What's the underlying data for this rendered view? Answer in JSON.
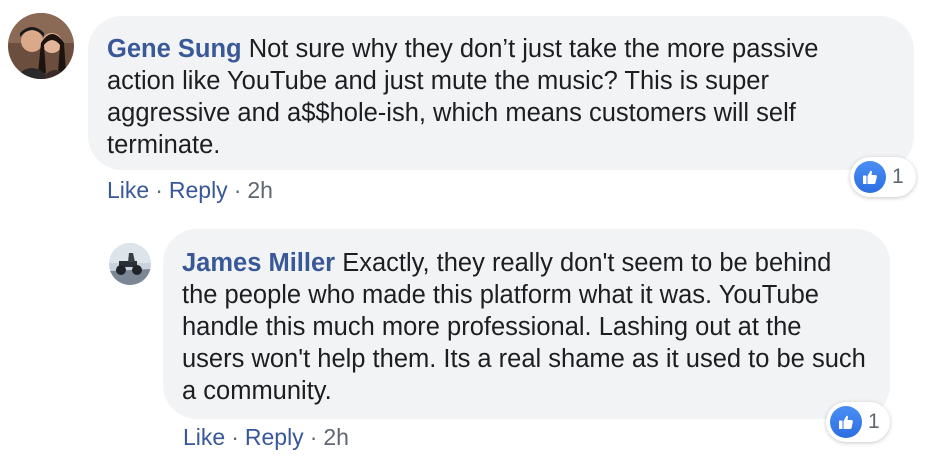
{
  "comments": [
    {
      "author": "Gene Sung",
      "text": "Not sure why they don’t just take the more passive action like YouTube and just mute the music? This is super aggressive and a$$hole-ish, which means customers will self terminate.",
      "reaction_count": "1",
      "actions": {
        "like": "Like",
        "reply": "Reply",
        "separator": "·",
        "time": "2h"
      }
    },
    {
      "author": "James Miller",
      "text": "Exactly, they really don't seem to be behind the people who made this platform what it was. YouTube handle this much more professional. Lashing out at the users won't help them. Its a real shame as it used to be such a community.",
      "reaction_count": "1",
      "actions": {
        "like": "Like",
        "reply": "Reply",
        "separator": "·",
        "time": "2h"
      }
    }
  ],
  "icons": {
    "reaction": "thumbs-up-icon"
  },
  "colors": {
    "author": "#385898",
    "bubble": "#f2f3f5",
    "like_badge": "#3b78e7",
    "meta": "#606770"
  }
}
